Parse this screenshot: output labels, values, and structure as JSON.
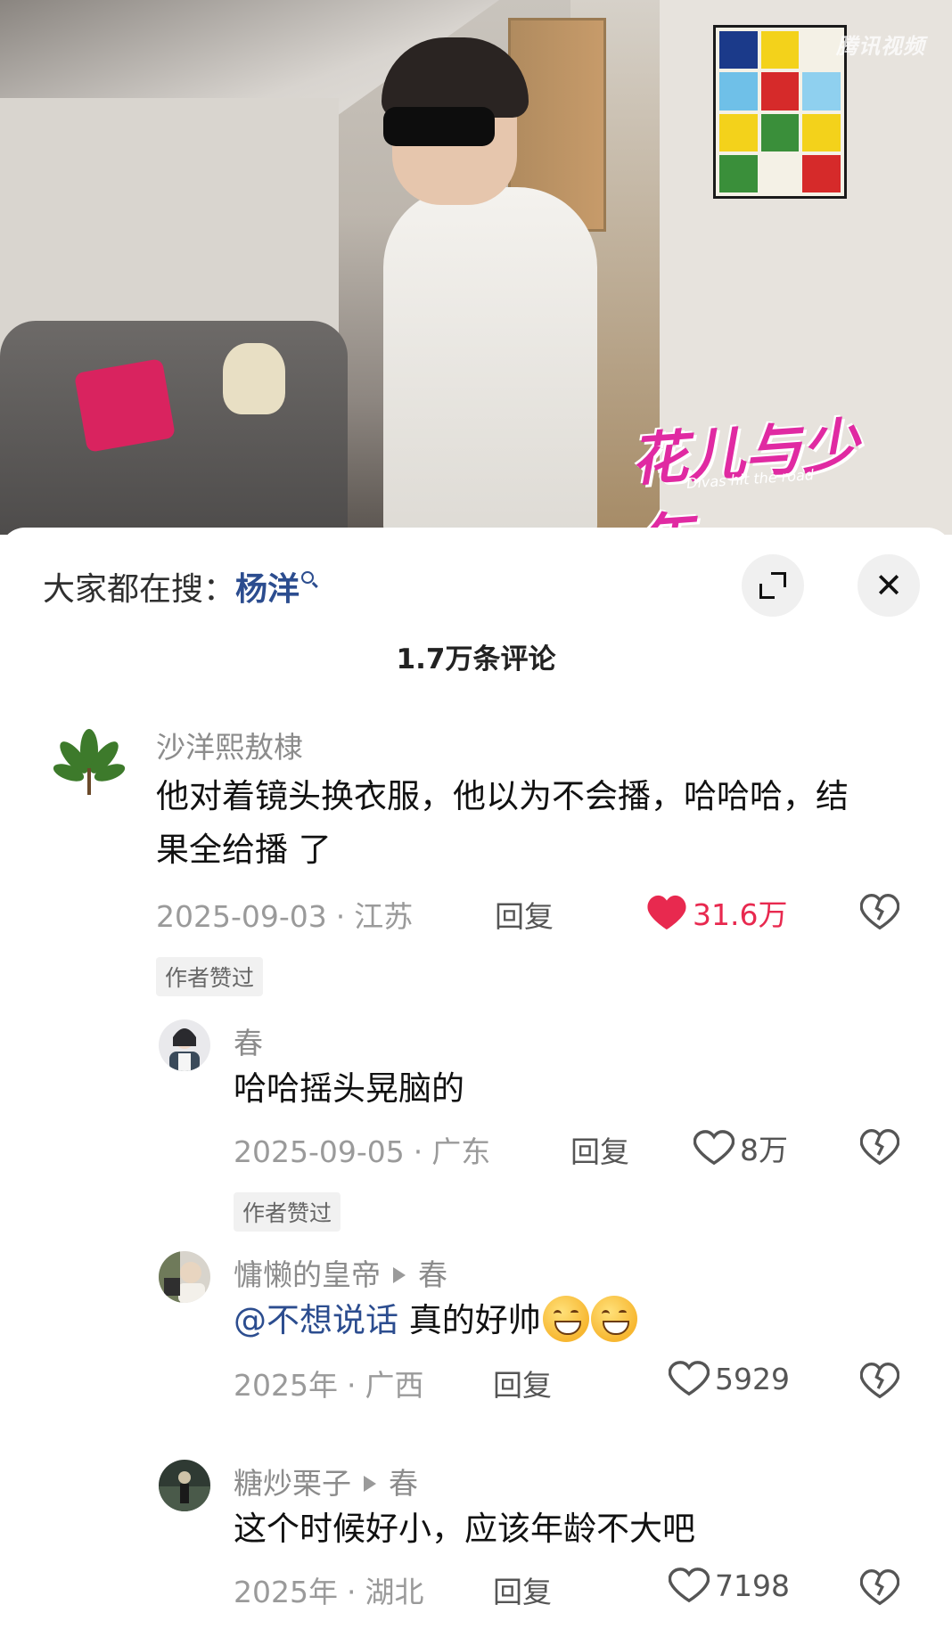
{
  "video": {
    "watermark": "腾讯视频",
    "show_title": "花儿与少年",
    "show_subtitle": "Divas hit the road"
  },
  "sheet": {
    "search_prefix": "大家都在搜：",
    "search_term": "杨洋",
    "comment_count": "1.7万条评论"
  },
  "comments": [
    {
      "username": "沙洋熙敖棣",
      "text": "他对着镜头换衣服，他以为不会播，哈哈哈，结果全给播 了",
      "date": "2025-09-03",
      "location": "江苏",
      "reply_label": "回复",
      "likes": "31.6万",
      "liked": true,
      "author_tag": "作者赞过"
    },
    {
      "username": "春",
      "text": "哈哈摇头晃脑的",
      "date": "2025-09-05",
      "location": "广东",
      "reply_label": "回复",
      "likes": "8万",
      "liked": false,
      "author_tag": "作者赞过"
    },
    {
      "username": "慵懒的皇帝",
      "reply_to": "春",
      "mention": "@不想说话",
      "text": " 真的好帅",
      "date": "2025年",
      "location": "广西",
      "reply_label": "回复",
      "likes": "5929",
      "liked": false
    },
    {
      "username": "糖炒栗子",
      "reply_to": "春",
      "text": "这个时候好小，应该年龄不大吧",
      "date": "2025年",
      "location": "湖北",
      "reply_label": "回复",
      "likes": "7198",
      "liked": false
    }
  ],
  "colors": {
    "accent_link": "#2c4d8f",
    "like_red": "#e8294f",
    "meta_gray": "#9a9a9a"
  },
  "icons": {
    "expand": "expand-icon",
    "close": "close-icon",
    "heart": "heart-icon",
    "dislike": "broken-heart-icon",
    "search": "search-icon"
  }
}
